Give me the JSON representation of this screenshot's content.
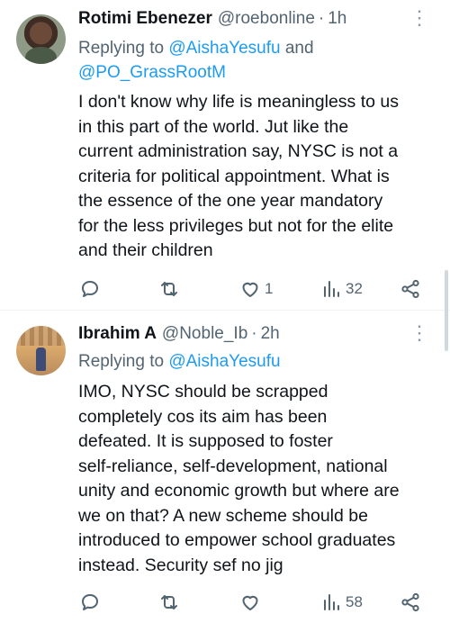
{
  "tweets": [
    {
      "name": "Rotimi Ebenezer",
      "handle": "@roebonline",
      "time": "1h",
      "replying_prefix": "Replying to ",
      "mentions_line1": "@AishaYesufu",
      "replying_and": " and",
      "mentions_line2": "@PO_GrassRootM",
      "body_lines": [
        "I don't know why life is meaningless to us",
        "in this part of the world. Jut like the",
        "current administration say, NYSC is not a",
        "criteria for political appointment. What is",
        "the essence of the one year mandatory",
        "for the less privileges but not for the elite",
        "and their children"
      ],
      "likes": "1",
      "views": "32",
      "more_icon": "⋮"
    },
    {
      "name": "Ibrahim A",
      "handle": "@Noble_Ib",
      "time": "2h",
      "replying_prefix": "Replying to ",
      "mentions_line1": "@AishaYesufu",
      "body_lines": [
        "IMO, NYSC should be scrapped",
        "completely cos its aim has been",
        "defeated. It is supposed to foster",
        "self-reliance, self-development, national",
        "unity and economic growth but where are",
        "we on that? A new scheme should be",
        "introduced to empower school graduates",
        "instead. Security sef no jig"
      ],
      "views": "58",
      "more_icon": "⋮"
    }
  ],
  "separator": "·"
}
